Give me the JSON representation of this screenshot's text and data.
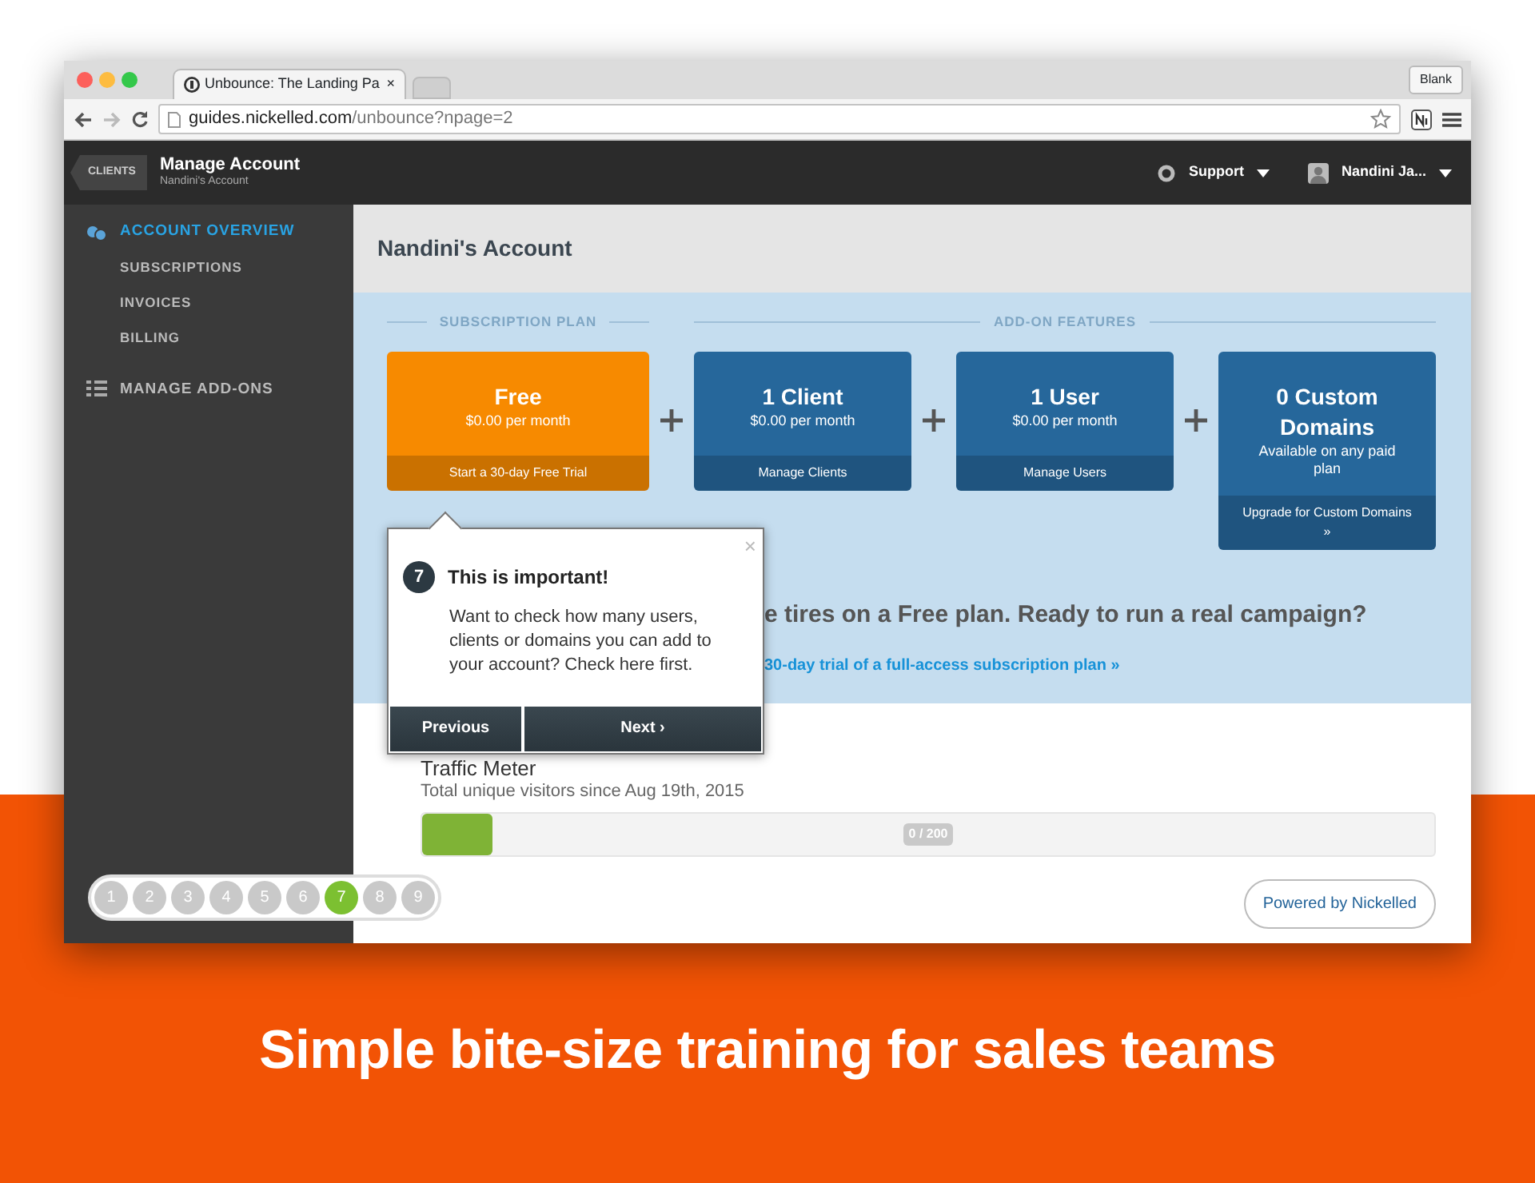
{
  "browser": {
    "tab_title": "Unbounce: The Landing Pa",
    "tab_close": "×",
    "profile_button": "Blank",
    "url_host": "guides.nickelled.com",
    "url_path": "/unbounce?npage=2"
  },
  "app_header": {
    "back_button": "CLIENTS",
    "title": "Manage Account",
    "subtitle": "Nandini's Account",
    "support": "Support",
    "user": "Nandini Ja..."
  },
  "sidebar": {
    "items": [
      {
        "label": "ACCOUNT OVERVIEW",
        "selected": true,
        "children": [
          {
            "label": "SUBSCRIPTIONS",
            "selected": false
          },
          {
            "label": "INVOICES",
            "selected": false
          },
          {
            "label": "BILLING",
            "selected": false
          }
        ]
      },
      {
        "label": "MANAGE ADD-ONS",
        "selected": false
      }
    ]
  },
  "page": {
    "title": "Nandini's Account",
    "sections": [
      {
        "label": "SUBSCRIPTION PLAN",
        "cards": [
          {
            "title": "Free",
            "subtitle": "$0.00 per month",
            "action": "Start a 30-day Free Trial",
            "color": "#f78a00"
          }
        ]
      },
      {
        "label": "ADD-ON FEATURES",
        "cards": [
          {
            "title": "1 Client",
            "subtitle": "$0.00 per month",
            "action": "Manage Clients",
            "color": "#26679b"
          },
          {
            "title": "1 User",
            "subtitle": "$0.00 per month",
            "action": "Manage Users",
            "color": "#26679b"
          },
          {
            "title": "0 Custom Domains",
            "subtitle": "Available on any paid plan",
            "action": "Upgrade for Custom Domains »",
            "color": "#26679b"
          }
        ]
      }
    ],
    "promo": "e tires on a Free plan. Ready to run a real campaign?",
    "promo_link": "30-day trial of a full-access subscription plan »",
    "meter": {
      "title": "Traffic Meter",
      "subtitle": "Total unique visitors since Aug 19th, 2015",
      "level": 0.07,
      "reading": "0 / 200"
    },
    "powered_by": "Powered by Nickelled"
  },
  "tour": {
    "step": "7",
    "title": "This is important!",
    "body": "Want to check how many users, clients or domains you can add to your account? Check here first.",
    "close": "×",
    "previous": "Previous",
    "next": "Next ›",
    "steps": [
      {
        "label": "1",
        "selected": false
      },
      {
        "label": "2",
        "selected": false
      },
      {
        "label": "3",
        "selected": false
      },
      {
        "label": "4",
        "selected": false
      },
      {
        "label": "5",
        "selected": false
      },
      {
        "label": "6",
        "selected": false
      },
      {
        "label": "7",
        "selected": true
      },
      {
        "label": "8",
        "selected": false
      },
      {
        "label": "9",
        "selected": false
      }
    ]
  },
  "caption": "Simple bite-size training for sales teams"
}
